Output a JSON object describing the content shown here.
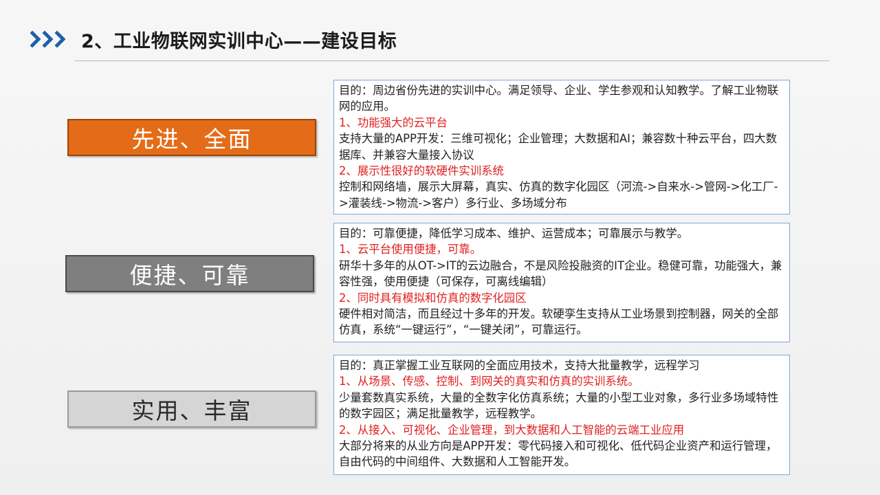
{
  "header": {
    "title": "2、工业物联网实训中心——建设目标",
    "icon": "triple-chevron-right-icon",
    "accent_color": "#1f5fa8"
  },
  "sections": [
    {
      "label": "先进、全面",
      "color": "#e46c18",
      "lines": [
        {
          "text": "目的：周边省份先进的实训中心。满足领导、企业、学生参观和认知教学。了解工业物联网的应用。",
          "highlight": false
        },
        {
          "text": "1、功能强大的云平台",
          "highlight": true
        },
        {
          "text": "支持大量的APP开发：三维可视化；企业管理；大数据和AI；兼容数十种云平台，四大数据库、并兼容大量接入协议",
          "highlight": false
        },
        {
          "text": "2、展示性很好的软硬件实训系统",
          "highlight": true
        },
        {
          "text": "控制和网络墙，展示大屏幕，真实、仿真的数字化园区（河流->自来水->管网->化工厂->灌装线->物流->客户）多行业、多场域分布",
          "highlight": false
        }
      ]
    },
    {
      "label": "便捷、可靠",
      "color": "#7f7f7f",
      "lines": [
        {
          "text": "目的：可靠便捷，降低学习成本、维护、运营成本；可靠展示与教学。",
          "highlight": false
        },
        {
          "text": "1、云平台使用便捷，可靠。",
          "highlight": true
        },
        {
          "text": "研华十多年的从OT->IT的云边融合，不是风险投融资的IT企业。稳健可靠，功能强大，兼容性强，使用便捷（可保存，可离线编辑）",
          "highlight": false
        },
        {
          "text": "2、同时具有模拟和仿真的数字化园区",
          "highlight": true
        },
        {
          "text": "硬件相对简洁，而且经过十多年的开发。软硬孪生支持从工业场景到控制器，网关的全部仿真，系统“一键运行”，“一键关闭”，可靠运行。",
          "highlight": false
        }
      ]
    },
    {
      "label": "实用、丰富",
      "color": "#d5d5d5",
      "lines": [
        {
          "text": "目的：真正掌握工业互联网的全面应用技术，支持大批量教学，远程学习",
          "highlight": false
        },
        {
          "text": "1、从场景、传感、控制、到网关的真实和仿真的实训系统。",
          "highlight": true
        },
        {
          "text": "少量套数真实系统，大量的全数字化仿真系统；大量的小型工业对象，多行业多场域特性的数字园区；满足批量教学，远程教学。",
          "highlight": false
        },
        {
          "text": "2、从接入、可视化、企业管理，到大数据和人工智能的云端工业应用",
          "highlight": true
        },
        {
          "text": "大部分将来的从业方向是APP开发：零代码接入和可视化、低代码企业资产和运行管理，自由代码的中间组件、大数据和人工智能开发。",
          "highlight": false
        }
      ]
    }
  ]
}
